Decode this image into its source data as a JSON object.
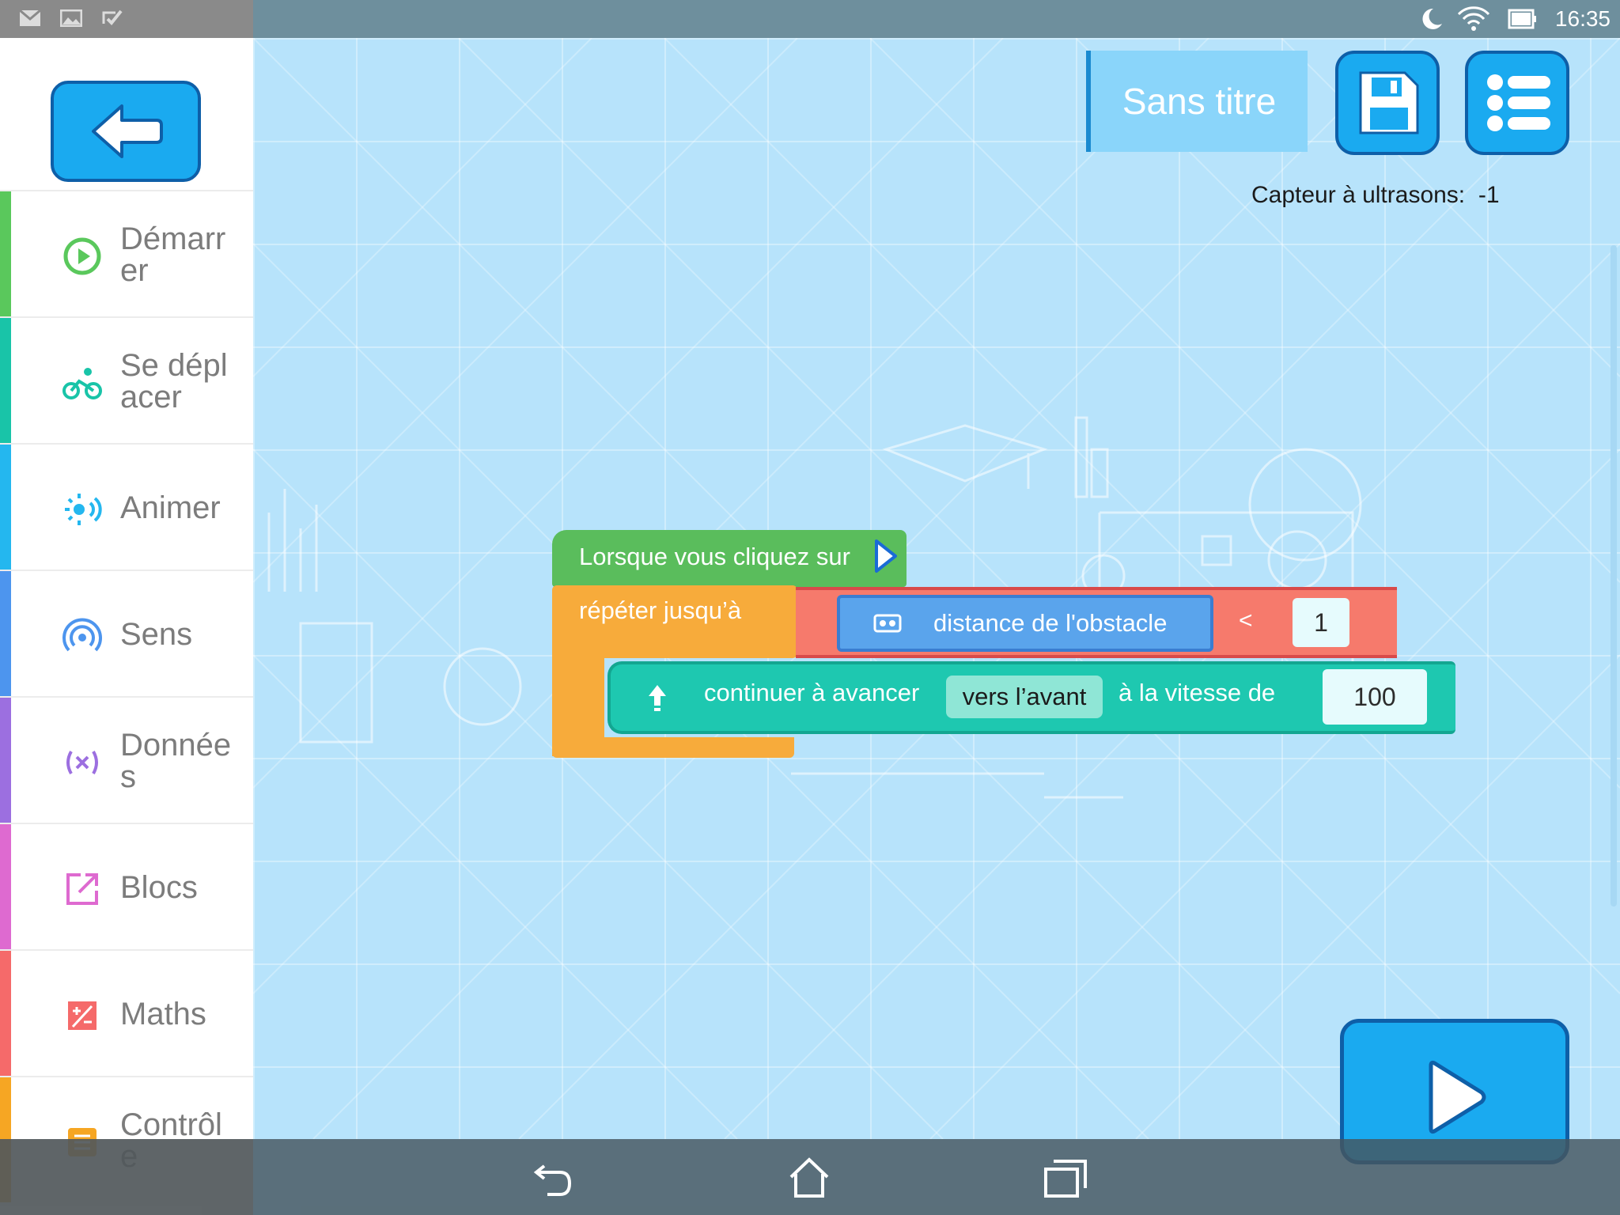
{
  "status_bar": {
    "left_icons": [
      "gmail-icon",
      "image-icon",
      "task-check-icon"
    ],
    "right_icons": [
      "moon-icon",
      "wifi-icon",
      "battery-icon"
    ],
    "time": "16:35"
  },
  "sidebar": {
    "back_icon": "arrow-left-icon",
    "categories": [
      {
        "label": "Démarrer",
        "display": "Démarr er",
        "icon": "play-circle-icon",
        "color": "#5ac85c"
      },
      {
        "label": "Se déplacer",
        "display": "Se dépl acer",
        "icon": "bicycle-icon",
        "color": "#19c4a8"
      },
      {
        "label": "Animer",
        "display": "Animer",
        "icon": "light-sound-icon",
        "color": "#24b7ef"
      },
      {
        "label": "Sens",
        "display": "Sens",
        "icon": "sensor-signal-icon",
        "color": "#4d95ee"
      },
      {
        "label": "Données",
        "display": "Donnée s",
        "icon": "variable-x-icon",
        "color": "#9c6fe0"
      },
      {
        "label": "Blocs",
        "display": "Blocs",
        "icon": "external-box-icon",
        "color": "#de6ad0"
      },
      {
        "label": "Maths",
        "display": "Maths",
        "icon": "math-square-icon",
        "color": "#f56a6a"
      },
      {
        "label": "Contrôle",
        "display": "Contrôl e",
        "icon": "list-icon",
        "color": "#f6a623"
      }
    ]
  },
  "header": {
    "title": "Sans titre",
    "save_icon": "floppy-save-icon",
    "menu_icon": "list-menu-icon",
    "sensor_label": "Capteur à ultrasons:",
    "sensor_value": "-1"
  },
  "program": {
    "start_block": "Lorsque vous cliquez sur",
    "loop_block": "répéter jusqu’à",
    "condition": {
      "sensor_block": "distance de l'obstacle",
      "operator": "<",
      "value": "1"
    },
    "move_block": {
      "label": "continuer à avancer",
      "direction": "vers l’avant",
      "speed_label": "à la vitesse de",
      "speed": "100"
    }
  },
  "run_icon": "play-icon",
  "nav": {
    "back": "back-icon",
    "home": "home-icon",
    "recents": "recents-icon"
  }
}
